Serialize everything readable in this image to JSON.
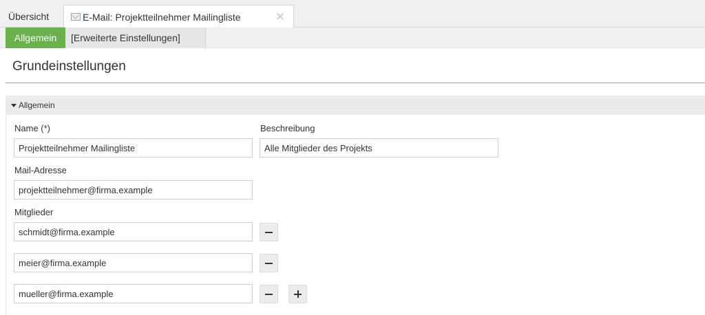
{
  "tabs": {
    "overview_label": "Übersicht",
    "email_tab_label": "E-Mail: Projektteilnehmer Mailingliste",
    "close_symbol": "✕"
  },
  "subtabs": {
    "general_label": "Allgemein",
    "advanced_label": "[Erweiterte Einstellungen]"
  },
  "page": {
    "title": "Grundeinstellungen"
  },
  "section": {
    "title": "Allgemein",
    "name_label": "Name (*)",
    "name_value": "Projektteilnehmer Mailingliste",
    "description_label": "Beschreibung",
    "description_value": "Alle Mitglieder des Projekts",
    "mail_label": "Mail-Adresse",
    "mail_value": "projektteilnehmer@firma.example",
    "members_label": "Mitglieder",
    "members": [
      "schmidt@firma.example",
      "meier@firma.example",
      "mueller@firma.example"
    ]
  },
  "colors": {
    "active_subtab": "#6ab04c"
  }
}
